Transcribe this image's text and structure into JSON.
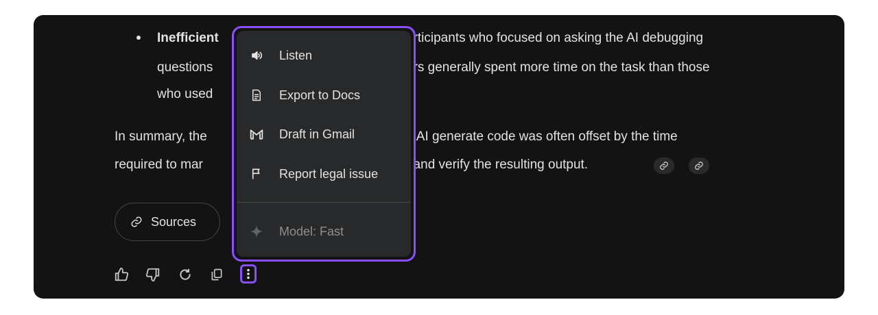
{
  "content": {
    "bullet_bold": "Inefficient",
    "line1_visible": "articipants who focused on asking the AI debugging",
    "line2_left": "questions",
    "line2_right": "ers generally spent more time on the task than those",
    "line3_left": "who used",
    "summary_line1_left": "In summary, the",
    "summary_line1_right": "e AI generate code was often offset by the time",
    "summary_line2_left": "required to mar",
    "summary_line2_right": ", and verify the resulting output.",
    "citation_icon": "link-icon"
  },
  "sources_button": {
    "label": "Sources",
    "icon": "link-icon"
  },
  "actions": [
    {
      "icon": "thumb-up-icon"
    },
    {
      "icon": "thumb-down-icon"
    },
    {
      "icon": "regenerate-icon"
    },
    {
      "icon": "copy-icon"
    },
    {
      "icon": "more-vert-icon"
    }
  ],
  "menu": {
    "items": [
      {
        "label": "Listen",
        "icon": "speaker-icon",
        "enabled": true
      },
      {
        "label": "Export to Docs",
        "icon": "docs-icon",
        "enabled": true
      },
      {
        "label": "Draft in Gmail",
        "icon": "gmail-icon",
        "enabled": true
      },
      {
        "label": "Report legal issue",
        "icon": "flag-icon",
        "enabled": true
      }
    ],
    "model_label": "Model: Fast",
    "model_icon": "sparkle-icon"
  },
  "colors": {
    "panel_bg": "#131314",
    "menu_bg": "#28292a",
    "text": "#e3e3e3",
    "highlight": "#8a4fff"
  }
}
